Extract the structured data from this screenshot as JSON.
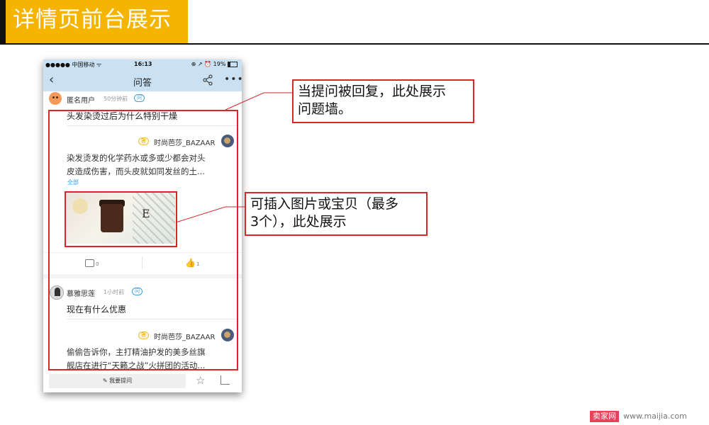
{
  "slide": {
    "title": "详情页前台展示"
  },
  "phone": {
    "status": {
      "carrier": "●●●●● 中国移动 ᯤ",
      "time": "16:13",
      "right": "⊕ ↗ ⏰ 19%"
    },
    "nav": {
      "back": "‹",
      "title": "问答",
      "more": "•••"
    },
    "q1": {
      "user": "匿名用户",
      "time": "50分钟前",
      "ask_badge": "问",
      "question": "头发染烫过后为什么特别干燥",
      "answer_badge": "答",
      "store": "时尚芭莎_BAZAAR",
      "answer_line1": "染发烫发的化学药水或多或少都会对头",
      "answer_line2": "皮造成伤害，而头皮就如同发丝的土...",
      "more": "全部",
      "image_logo": "E",
      "comment_count": "0",
      "like_count": "1"
    },
    "q2": {
      "user": "慕雅思莲",
      "time": "1小时前",
      "ask_badge": "问",
      "question": "现在有什么优惠",
      "answer_badge": "答",
      "store": "时尚芭莎_BAZAAR",
      "answer_line1": "偷偷告诉你，主打精油护发的美多丝旗",
      "answer_line2": "舰店在进行“天籁之战”火拼团的活动..."
    },
    "bottom": {
      "ask_button": "✎ 我要提问",
      "star": "☆"
    }
  },
  "callouts": {
    "wall_line1": "当提问被回复，此处展示",
    "wall_line2": "问题墙。",
    "image_line1": "可插入图片或宝贝（最多",
    "image_line2": "3个），此处展示"
  },
  "watermark": {
    "badge": "卖家网",
    "url": "www.maijia.com"
  },
  "colors": {
    "title_bg": "#f5b400",
    "annotation_red": "#d9262b",
    "phone_header": "#c9e1f2"
  }
}
